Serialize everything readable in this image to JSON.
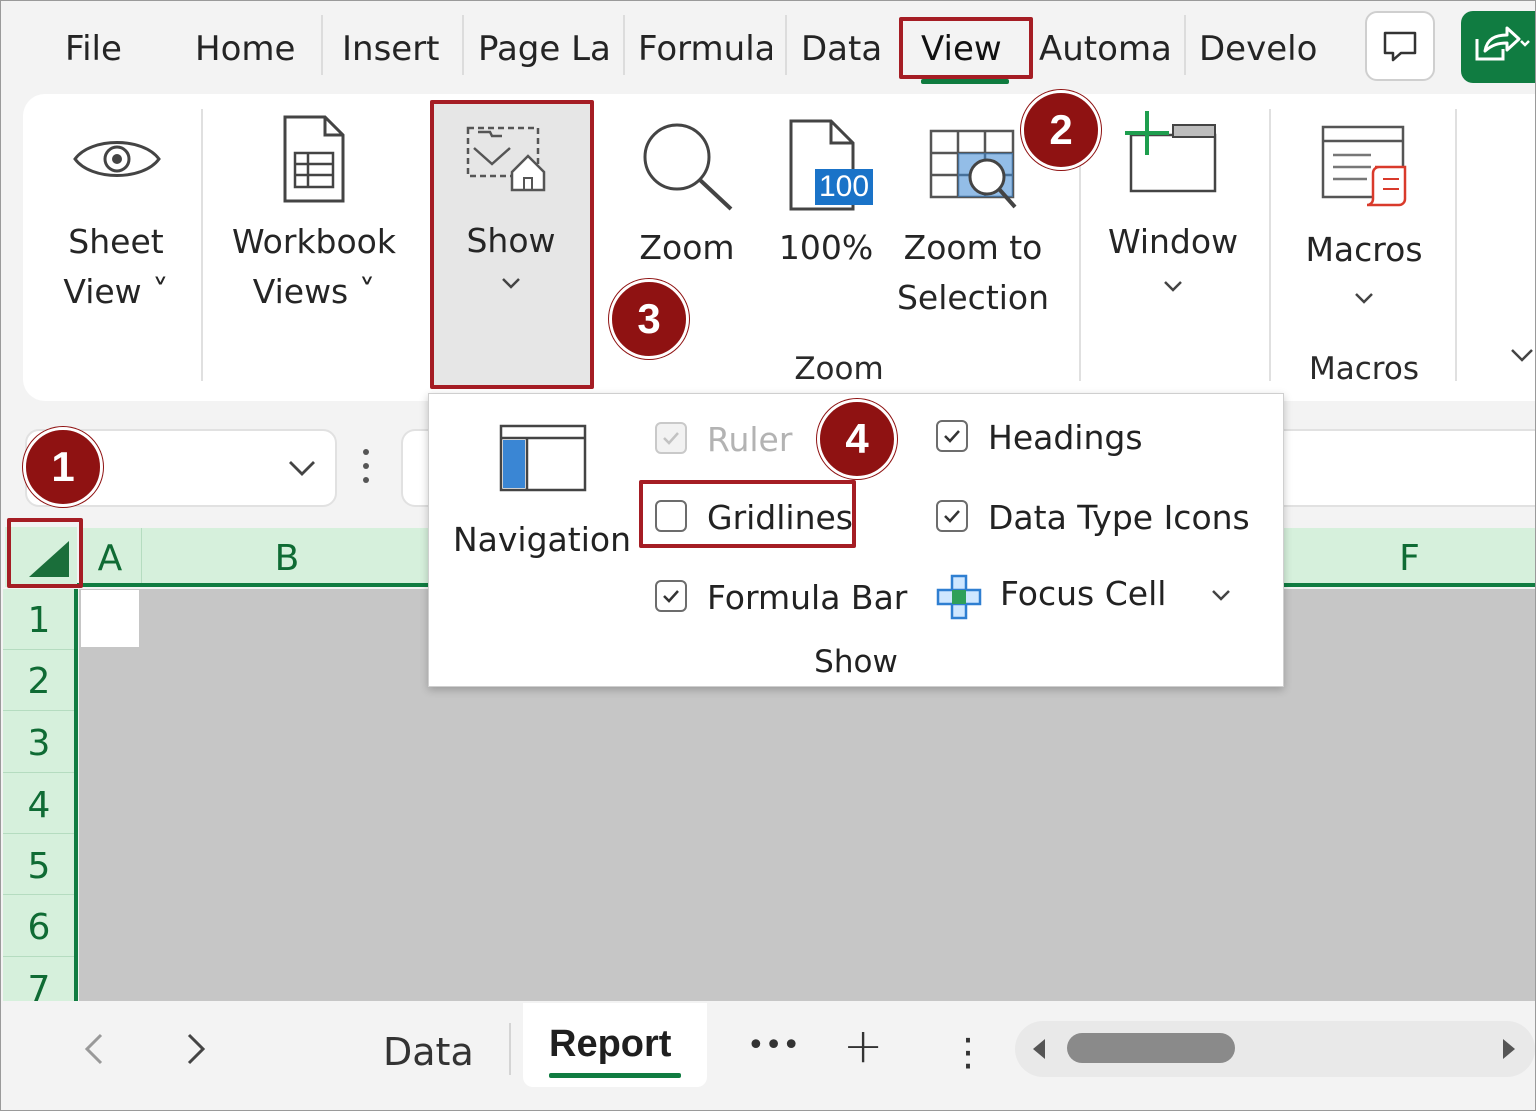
{
  "tabs": {
    "file": "File",
    "home": "Home",
    "insert": "Insert",
    "page_layout": "Page La",
    "formulas": "Formula",
    "data": "Data",
    "view": "View",
    "automate": "Automa",
    "developer": "Develo"
  },
  "ribbon": {
    "sheet_view": [
      "Sheet",
      "View ˅"
    ],
    "workbook_views": [
      "Workbook",
      "Views ˅"
    ],
    "show": "Show",
    "zoom": "Zoom",
    "zoom_100": "100%",
    "zoom_100_badge": "100",
    "zoom_to_selection": [
      "Zoom to",
      "Selection"
    ],
    "window": "Window",
    "macros": "Macros",
    "group_zoom": "Zoom",
    "group_macros": "Macros"
  },
  "show_menu": {
    "navigation": "Navigation",
    "ruler": "Ruler",
    "gridlines": "Gridlines",
    "formula_bar": "Formula Bar",
    "headings": "Headings",
    "data_type_icons": "Data Type Icons",
    "focus_cell": "Focus Cell",
    "group_label": "Show",
    "states": {
      "ruler": "checked-disabled",
      "gridlines": "unchecked",
      "formula_bar": "checked",
      "headings": "checked",
      "data_type_icons": "checked"
    }
  },
  "grid": {
    "columns": [
      "A",
      "B",
      "F"
    ],
    "rows": [
      "1",
      "2",
      "3",
      "4",
      "5",
      "6",
      "7"
    ]
  },
  "steps": [
    "1",
    "2",
    "3",
    "4"
  ],
  "sheet_tabs": {
    "data": "Data",
    "report": "Report",
    "more": "•••",
    "add": "+",
    "options": "⋮"
  },
  "colors": {
    "accent_green": "#107c41",
    "highlight_red": "#a51d24",
    "badge_red": "#8f1212",
    "header_green_bg": "#d6f0dc"
  }
}
